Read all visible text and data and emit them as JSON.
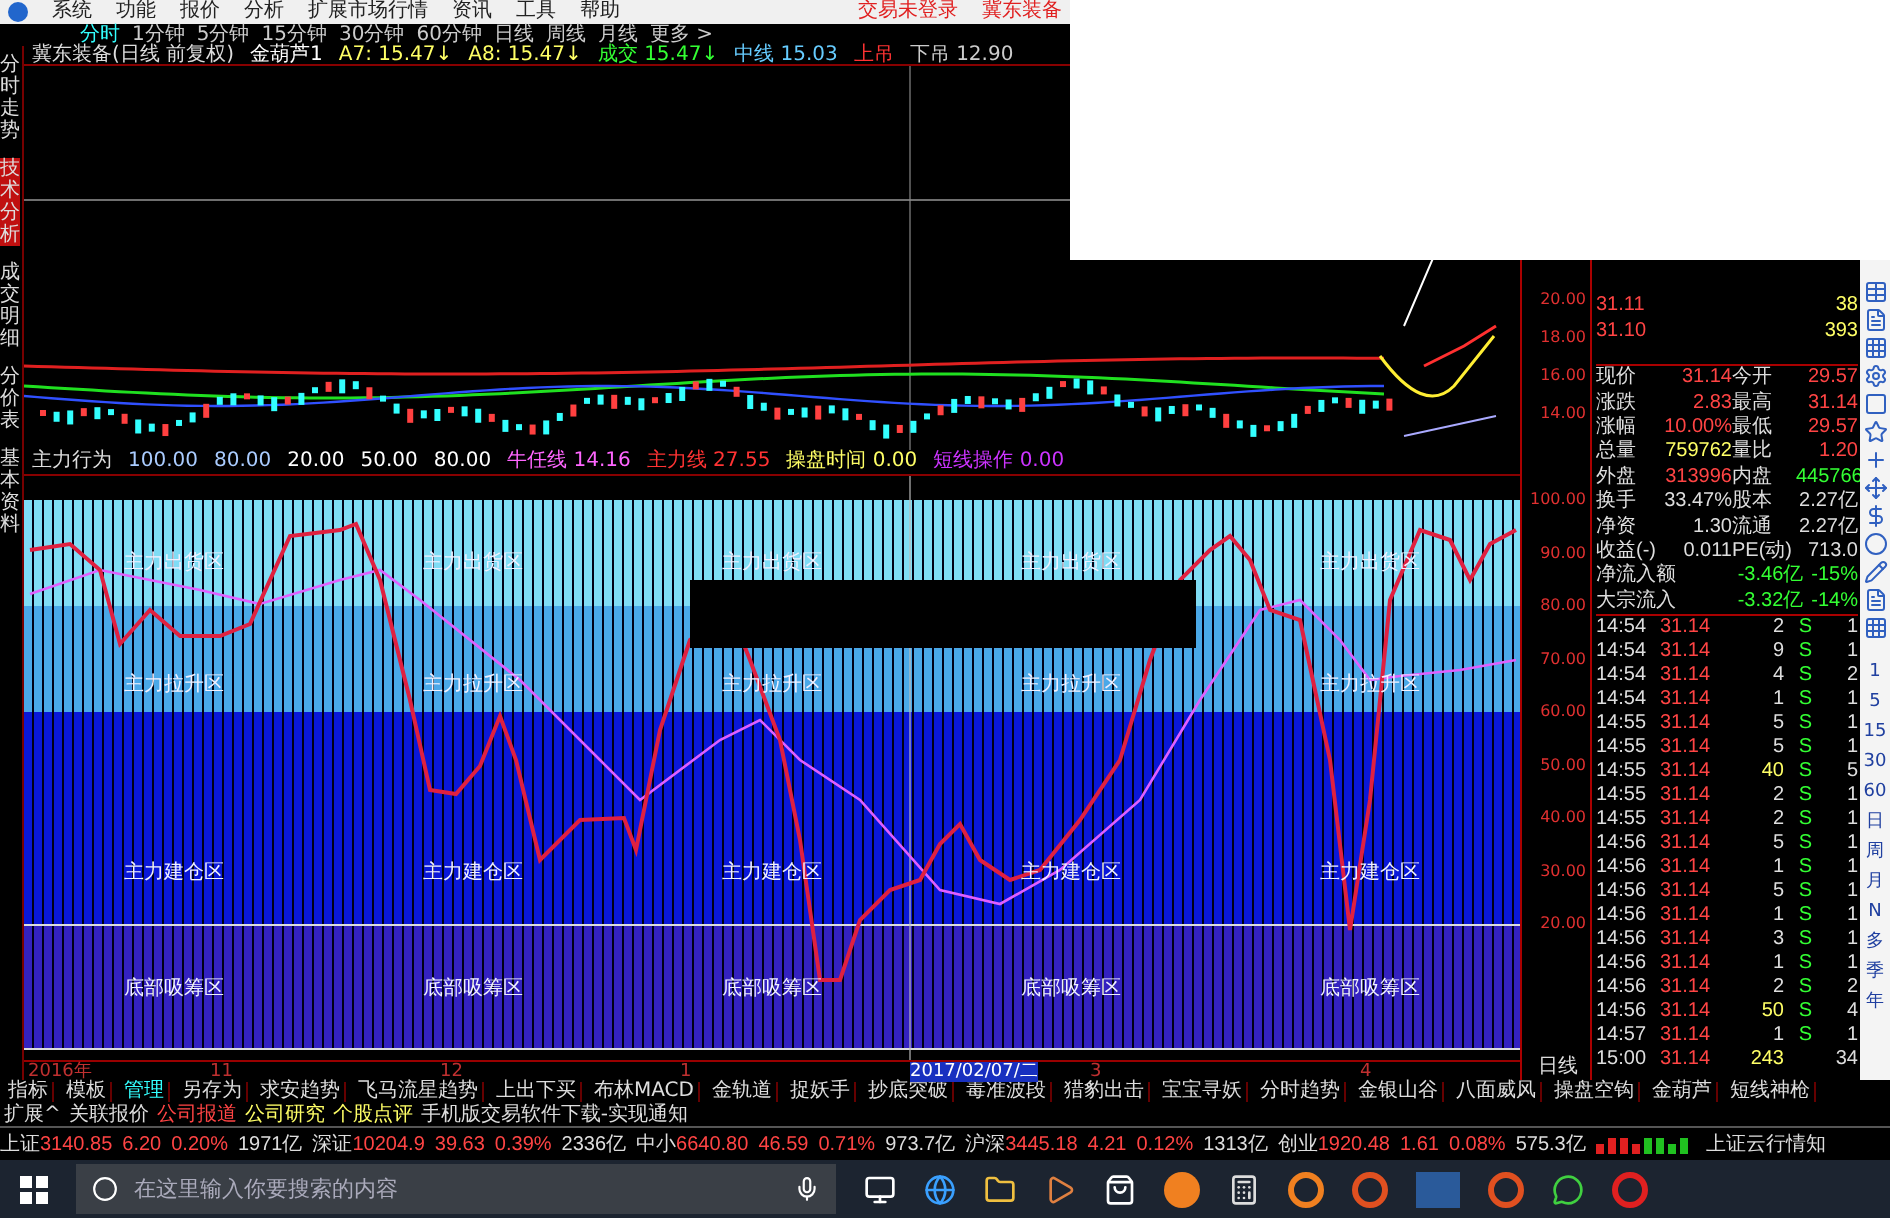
{
  "menu": {
    "items": [
      "系统",
      "功能",
      "报价",
      "分析",
      "扩展市场行情",
      "资讯",
      "工具",
      "帮助"
    ],
    "status": [
      "交易未登录",
      "冀东装备"
    ]
  },
  "side_tabs": [
    {
      "label": "分时走势",
      "selected": false
    },
    {
      "label": "技术分析",
      "selected": true
    },
    {
      "label": "成交明细",
      "selected": false
    },
    {
      "label": "分价表",
      "selected": false
    },
    {
      "label": "基本资料",
      "selected": false
    }
  ],
  "periods": [
    {
      "label": "分时",
      "selected": true
    },
    {
      "label": "1分钟",
      "selected": false
    },
    {
      "label": "5分钟",
      "selected": false
    },
    {
      "label": "15分钟",
      "selected": false
    },
    {
      "label": "30分钟",
      "selected": false
    },
    {
      "label": "60分钟",
      "selected": false
    },
    {
      "label": "日线",
      "selected": false
    },
    {
      "label": "周线",
      "selected": false
    },
    {
      "label": "月线",
      "selected": false
    },
    {
      "label": "更多 >",
      "selected": false
    }
  ],
  "kline_header": {
    "title": "冀东装备(日线 前复权)",
    "items": [
      {
        "text": "金葫芦1",
        "color": "#ffffff"
      },
      {
        "text": "A7: 15.47↓",
        "color": "#ffff66"
      },
      {
        "text": "A8: 15.47↓",
        "color": "#ffff66"
      },
      {
        "text": "成交 15.47↓",
        "color": "#33ff33"
      },
      {
        "text": "中线 15.03",
        "color": "#66ccff"
      },
      {
        "text": "上吊",
        "color": "#ff3333"
      },
      {
        "text": "下吊 12.90",
        "color": "#cccccc"
      }
    ]
  },
  "osc_header": {
    "title": "主力行为",
    "items": [
      {
        "text": "100.00",
        "color": "#aaccff"
      },
      {
        "text": "80.00",
        "color": "#aaccff"
      },
      {
        "text": "20.00",
        "color": "#ffffff"
      },
      {
        "text": "50.00",
        "color": "#ffffff"
      },
      {
        "text": "80.00",
        "color": "#ffffff"
      },
      {
        "text": "牛任线 14.16",
        "color": "#ff66ff"
      },
      {
        "text": "主力线 27.55",
        "color": "#ff3333"
      },
      {
        "text": "操盘时间 0.00",
        "color": "#ffff66"
      },
      {
        "text": "短线操作 0.00",
        "color": "#cc33ff"
      }
    ]
  },
  "zones": [
    {
      "color": "#7fdcf5",
      "labels": [
        "主力出货区",
        "主力出货区",
        "主力出货区",
        "主力出货区",
        "主力出货区"
      ]
    },
    {
      "color": "#4aa8e8",
      "labels": [
        "主力拉升区",
        "主力拉升区",
        "主力拉升区",
        "主力拉升区",
        "主力拉升区"
      ]
    },
    {
      "color": "#0a18d8",
      "labels": [
        "主力建仓区",
        "主力建仓区",
        "主力建仓区",
        "主力建仓区",
        "主力建仓区"
      ]
    },
    {
      "color": "#3422c0",
      "labels": [
        "底部吸筹区",
        "底部吸筹区",
        "底部吸筹区",
        "底部吸筹区",
        "底部吸筹区"
      ]
    }
  ],
  "axis": {
    "price_ticks": [
      "20.00",
      "18.00",
      "16.00",
      "14.00"
    ],
    "osc_ticks": [
      "100.00",
      "90.00",
      "80.00",
      "70.00",
      "60.00",
      "50.00",
      "40.00",
      "30.00",
      "20.00"
    ],
    "period": "日线"
  },
  "date_axis": [
    {
      "label": "2016年",
      "selected": false
    },
    {
      "label": "11",
      "selected": false
    },
    {
      "label": "12",
      "selected": false
    },
    {
      "label": "1",
      "selected": false
    },
    {
      "label": "2017/02/07/二",
      "selected": true
    },
    {
      "label": "3",
      "selected": false
    },
    {
      "label": "4",
      "selected": false
    }
  ],
  "order_book": [
    {
      "price": "31.11",
      "volume": "38"
    },
    {
      "price": "31.10",
      "volume": "393"
    }
  ],
  "quote": [
    [
      {
        "text": "现价",
        "color": "#dddddd"
      },
      {
        "text": "31.14",
        "color": "#ff4444"
      },
      {
        "text": "今开",
        "color": "#dddddd"
      },
      {
        "text": "29.57",
        "color": "#ff4444"
      }
    ],
    [
      {
        "text": "涨跌",
        "color": "#dddddd"
      },
      {
        "text": "2.83",
        "color": "#ff4444"
      },
      {
        "text": "最高",
        "color": "#dddddd"
      },
      {
        "text": "31.14",
        "color": "#ff4444"
      }
    ],
    [
      {
        "text": "涨幅",
        "color": "#dddddd"
      },
      {
        "text": "10.00%",
        "color": "#ff4444"
      },
      {
        "text": "最低",
        "color": "#dddddd"
      },
      {
        "text": "29.57",
        "color": "#ff4444"
      }
    ],
    [
      {
        "text": "总量",
        "color": "#dddddd"
      },
      {
        "text": "759762",
        "color": "#ffff66"
      },
      {
        "text": "量比",
        "color": "#dddddd"
      },
      {
        "text": "1.20",
        "color": "#ff4444"
      }
    ],
    [
      {
        "text": "外盘",
        "color": "#dddddd"
      },
      {
        "text": "313996",
        "color": "#ff4444"
      },
      {
        "text": "内盘",
        "color": "#dddddd"
      },
      {
        "text": "445766",
        "color": "#33ff33"
      }
    ],
    [
      {
        "text": "换手",
        "color": "#dddddd"
      },
      {
        "text": "33.47%",
        "color": "#dddddd"
      },
      {
        "text": "股本",
        "color": "#dddddd"
      },
      {
        "text": "2.27亿",
        "color": "#dddddd"
      }
    ],
    [
      {
        "text": "净资",
        "color": "#dddddd"
      },
      {
        "text": "1.30",
        "color": "#dddddd"
      },
      {
        "text": "流通",
        "color": "#dddddd"
      },
      {
        "text": "2.27亿",
        "color": "#dddddd"
      }
    ],
    [
      {
        "text": "收益(-)",
        "color": "#dddddd"
      },
      {
        "text": "0.011",
        "color": "#dddddd"
      },
      {
        "text": "PE(动)",
        "color": "#dddddd"
      },
      {
        "text": "713.0",
        "color": "#dddddd"
      }
    ],
    [
      {
        "text": "净流入额",
        "color": "#dddddd"
      },
      {
        "text": "-3.46亿",
        "color": "#33ff33"
      },
      {
        "text": "-15%",
        "color": "#33ff33"
      }
    ],
    [
      {
        "text": "大宗流入",
        "color": "#dddddd"
      },
      {
        "text": "-3.32亿",
        "color": "#33ff33"
      },
      {
        "text": "-14%",
        "color": "#33ff33"
      }
    ]
  ],
  "ticks": [
    {
      "time": "14:54",
      "price": "31.14",
      "volume": "2",
      "side": "S",
      "column_5": "1",
      "color": "#dddddd"
    },
    {
      "time": "14:54",
      "price": "31.14",
      "volume": "9",
      "side": "S",
      "column_5": "1",
      "color": "#dddddd"
    },
    {
      "time": "14:54",
      "price": "31.14",
      "volume": "4",
      "side": "S",
      "column_5": "2",
      "color": "#dddddd"
    },
    {
      "time": "14:54",
      "price": "31.14",
      "volume": "1",
      "side": "S",
      "column_5": "1",
      "color": "#dddddd"
    },
    {
      "time": "14:55",
      "price": "31.14",
      "volume": "5",
      "side": "S",
      "column_5": "1",
      "color": "#dddddd"
    },
    {
      "time": "14:55",
      "price": "31.14",
      "volume": "5",
      "side": "S",
      "column_5": "1",
      "color": "#dddddd"
    },
    {
      "time": "14:55",
      "price": "31.14",
      "volume": "40",
      "side": "S",
      "column_5": "5",
      "color": "#ffff66"
    },
    {
      "time": "14:55",
      "price": "31.14",
      "volume": "2",
      "side": "S",
      "column_5": "1",
      "color": "#dddddd"
    },
    {
      "time": "14:55",
      "price": "31.14",
      "volume": "2",
      "side": "S",
      "column_5": "1",
      "color": "#dddddd"
    },
    {
      "time": "14:56",
      "price": "31.14",
      "volume": "5",
      "side": "S",
      "column_5": "1",
      "color": "#dddddd"
    },
    {
      "time": "14:56",
      "price": "31.14",
      "volume": "1",
      "side": "S",
      "column_5": "1",
      "color": "#dddddd"
    },
    {
      "time": "14:56",
      "price": "31.14",
      "volume": "5",
      "side": "S",
      "column_5": "1",
      "color": "#dddddd"
    },
    {
      "time": "14:56",
      "price": "31.14",
      "volume": "1",
      "side": "S",
      "column_5": "1",
      "color": "#dddddd"
    },
    {
      "time": "14:56",
      "price": "31.14",
      "volume": "3",
      "side": "S",
      "column_5": "1",
      "color": "#dddddd"
    },
    {
      "time": "14:56",
      "price": "31.14",
      "volume": "1",
      "side": "S",
      "column_5": "1",
      "color": "#dddddd"
    },
    {
      "time": "14:56",
      "price": "31.14",
      "volume": "2",
      "side": "S",
      "column_5": "2",
      "color": "#dddddd"
    },
    {
      "time": "14:56",
      "price": "31.14",
      "volume": "50",
      "side": "S",
      "column_5": "4",
      "color": "#ffff66"
    },
    {
      "time": "14:57",
      "price": "31.14",
      "volume": "1",
      "side": "S",
      "column_5": "1",
      "color": "#dddddd"
    },
    {
      "time": "15:00",
      "price": "31.14",
      "volume": "243",
      "column_5": "34",
      "color": "#ffff66"
    }
  ],
  "side_periods": [
    "1",
    "5",
    "15",
    "30",
    "60",
    "日",
    "周",
    "月",
    "N",
    "多",
    "季",
    "年"
  ],
  "toolbar": [
    {
      "label": "指标",
      "selected": false
    },
    {
      "label": "模板",
      "selected": false
    },
    {
      "label": "管理",
      "selected": true
    },
    {
      "label": "另存为",
      "selected": false
    },
    {
      "label": "求安趋势",
      "selected": false
    },
    {
      "label": "飞马流星趋势",
      "selected": false
    },
    {
      "label": "上出下买",
      "selected": false
    },
    {
      "label": "布林MACD",
      "selected": false
    },
    {
      "label": "金轨道",
      "selected": false
    },
    {
      "label": "捉妖手",
      "selected": false
    },
    {
      "label": "抄底突破",
      "selected": false
    },
    {
      "label": "毒准波段",
      "selected": false
    },
    {
      "label": "猎豹出击",
      "selected": false
    },
    {
      "label": "宝宝寻妖",
      "selected": false
    },
    {
      "label": "分时趋势",
      "selected": false
    },
    {
      "label": "金银山谷",
      "selected": false
    },
    {
      "label": "八面威风",
      "selected": false
    },
    {
      "label": "操盘空钩",
      "selected": false
    },
    {
      "label": "金葫芦",
      "selected": false
    },
    {
      "label": "短线神枪",
      "selected": false
    }
  ],
  "info_bar": [
    {
      "text": "扩展^",
      "color": "#dddddd"
    },
    {
      "text": "关联报价",
      "color": "#dddddd"
    },
    {
      "text": "公司报道",
      "color": "#ff4444"
    },
    {
      "text": "公司研究",
      "color": "#ffff66"
    },
    {
      "text": "个股点评",
      "color": "#ffff66"
    },
    {
      "text": "手机版交易软件下载-实现通知",
      "color": "#dddddd"
    }
  ],
  "ticker": [
    {
      "name": "上证",
      "value": "3140.85",
      "change": "6.20",
      "pct": "0.20%",
      "amount": "1971亿"
    },
    {
      "name": "深证",
      "value": "10204.9",
      "change": "39.63",
      "pct": "0.39%",
      "amount": "2336亿"
    },
    {
      "name": "中小",
      "value": "6640.80",
      "change": "46.59",
      "pct": "0.71%",
      "amount": "973.7亿"
    },
    {
      "name": "沪深",
      "value": "3445.18",
      "change": "4.21",
      "pct": "0.12%",
      "amount": "1313亿"
    },
    {
      "name": "创业",
      "value": "1920.48",
      "change": "1.61",
      "pct": "0.08%",
      "amount": "575.3亿"
    }
  ],
  "ticker_tail": "上证云行情知",
  "taskbar": {
    "search_placeholder": "在这里输入你要搜索的内容"
  }
}
